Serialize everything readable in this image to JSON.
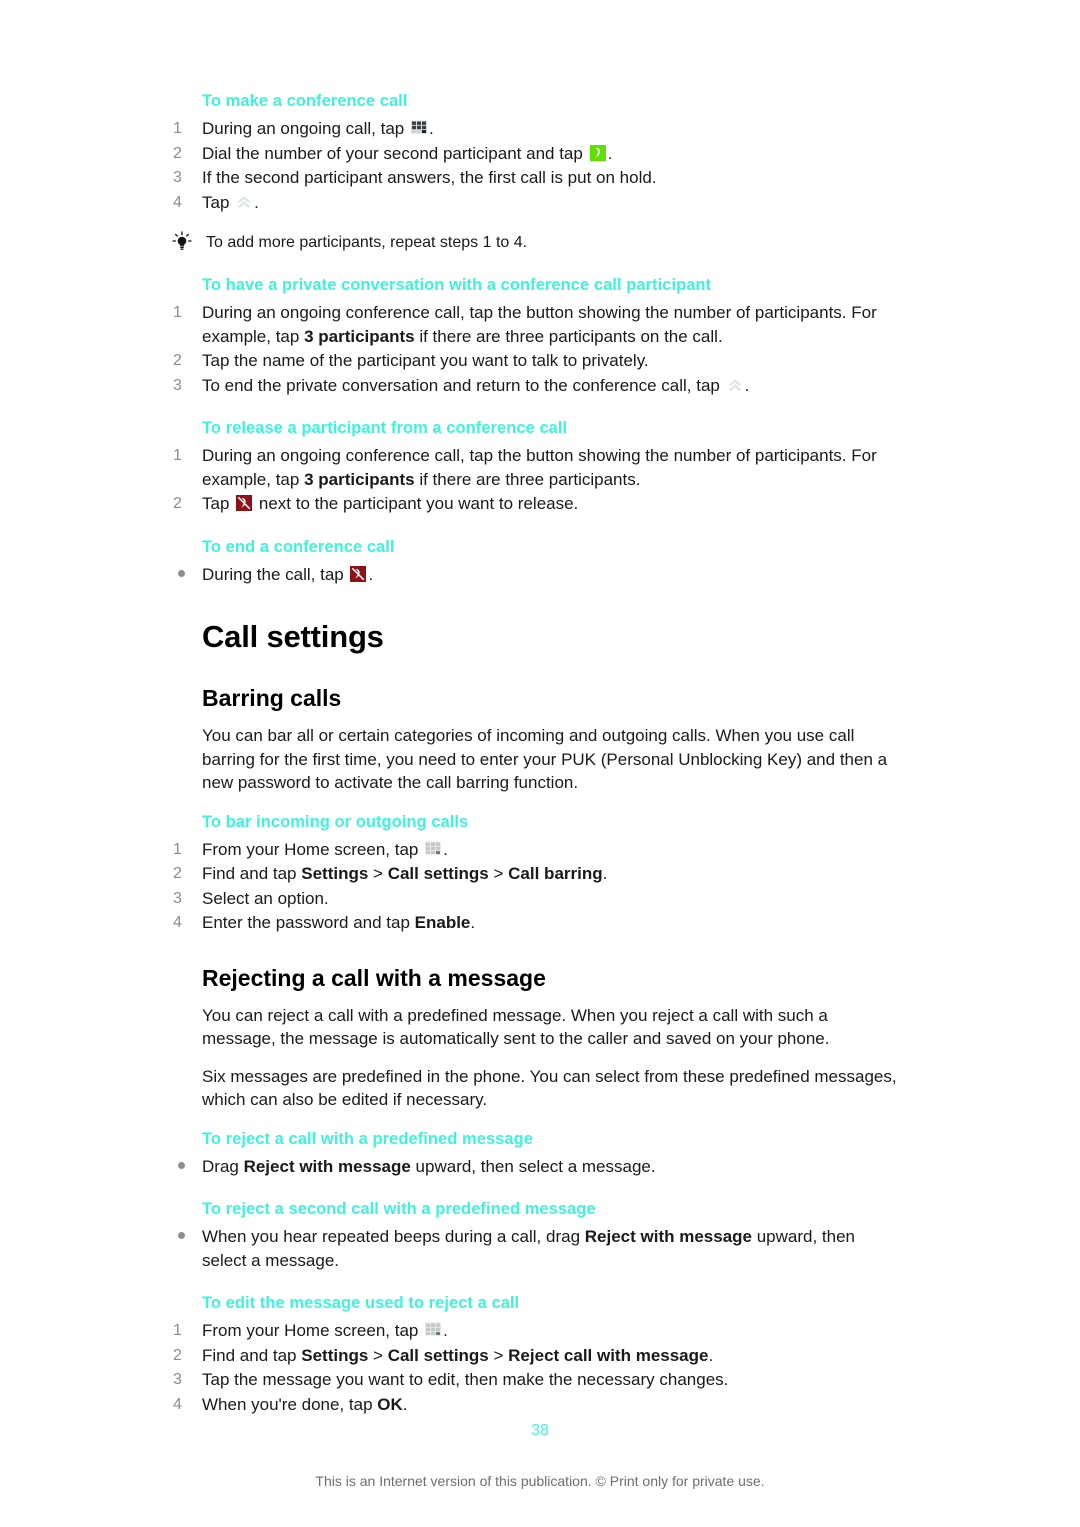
{
  "page": {
    "number": "38",
    "disclaimer": "This is an Internet version of this publication. © Print only for private use.",
    "accent_color": "#3ff2dc",
    "text_color": "#1a1a1a",
    "number_color": "#8b8b8b"
  },
  "sections": {
    "conference_call": {
      "heading": "To make a conference call",
      "steps": [
        {
          "num": "1",
          "pre": "During an ongoing call, tap ",
          "icon": "dialpad-icon",
          "post": "."
        },
        {
          "num": "2",
          "pre": "Dial the number of your second participant and tap ",
          "icon": "call-green-icon",
          "post": "."
        },
        {
          "num": "3",
          "pre": "If the second participant answers, the first call is put on hold.",
          "icon": "",
          "post": ""
        },
        {
          "num": "4",
          "pre": "Tap ",
          "icon": "merge-calls-icon",
          "post": "."
        }
      ],
      "tip": "To add more participants, repeat steps 1 to 4."
    },
    "private_conversation": {
      "heading": "To have a private conversation with a conference call participant",
      "steps": [
        {
          "num": "1",
          "pre": "During an ongoing conference call, tap the button showing the number of participants. For example, tap ",
          "bold": "3 participants",
          "post": " if there are three participants on the call."
        },
        {
          "num": "2",
          "pre": "Tap the name of the participant you want to talk to privately.",
          "bold": "",
          "post": ""
        },
        {
          "num": "3",
          "pre": "To end the private conversation and return to the conference call, tap ",
          "icon": "merge-calls-icon",
          "post": "."
        }
      ]
    },
    "release_participant": {
      "heading": "To release a participant from a conference call",
      "steps": [
        {
          "num": "1",
          "pre": "During an ongoing conference call, tap the button showing the number of participants. For example, tap ",
          "bold": "3 participants",
          "post": " if there are three participants."
        },
        {
          "num": "2",
          "pre": "Tap ",
          "icon": "end-call-icon",
          "post": " next to the participant you want to release."
        }
      ]
    },
    "end_conference": {
      "heading": "To end a conference call",
      "bullets": [
        {
          "pre": "During the call, tap ",
          "icon": "end-call-icon",
          "post": "."
        }
      ]
    },
    "call_settings": {
      "title": "Call settings",
      "barring": {
        "subtitle": "Barring calls",
        "paragraph": "You can bar all or certain categories of incoming and outgoing calls. When you use call barring for the first time, you need to enter your PUK (Personal Unblocking Key) and then a new password to activate the call barring function.",
        "heading": "To bar incoming or outgoing calls",
        "steps": [
          {
            "num": "1",
            "pre": "From your Home screen, tap ",
            "icon": "app-grid-icon",
            "post": "."
          },
          {
            "num": "2",
            "pre": "Find and tap ",
            "bold1": "Settings",
            "mid1": " > ",
            "bold2": "Call settings",
            "mid2": " > ",
            "bold3": "Call barring",
            "post": "."
          },
          {
            "num": "3",
            "pre": "Select an option.",
            "post": ""
          },
          {
            "num": "4",
            "pre": "Enter the password and tap ",
            "bold1": "Enable",
            "post": "."
          }
        ]
      },
      "rejecting": {
        "subtitle": "Rejecting a call with a message",
        "paragraph1": "You can reject a call with a predefined message. When you reject a call with such a message, the message is automatically sent to the caller and saved on your phone.",
        "paragraph2": "Six messages are predefined in the phone. You can select from these predefined messages, which can also be edited if necessary.",
        "reject_predefined": {
          "heading": "To reject a call with a predefined message",
          "bullets": [
            {
              "pre": "Drag ",
              "bold": "Reject with message",
              "post": " upward, then select a message."
            }
          ]
        },
        "reject_second": {
          "heading": "To reject a second call with a predefined message",
          "bullets": [
            {
              "pre": "When you hear repeated beeps during a call, drag ",
              "bold": "Reject with message",
              "post": " upward, then select a message."
            }
          ]
        },
        "edit_message": {
          "heading": "To edit the message used to reject a call",
          "steps": [
            {
              "num": "1",
              "pre": "From your Home screen, tap ",
              "icon": "app-grid-icon",
              "post": "."
            },
            {
              "num": "2",
              "pre": "Find and tap ",
              "bold1": "Settings",
              "mid1": " > ",
              "bold2": "Call settings",
              "mid2": " > ",
              "bold3": "Reject call with message",
              "post": "."
            },
            {
              "num": "3",
              "pre": "Tap the message you want to edit, then make the necessary changes.",
              "post": ""
            },
            {
              "num": "4",
              "pre": "When you're done, tap ",
              "bold1": "OK",
              "post": "."
            }
          ]
        }
      }
    }
  }
}
